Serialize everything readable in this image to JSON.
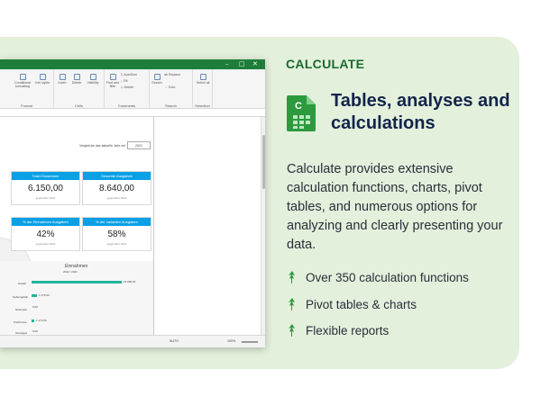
{
  "window": {
    "ribbon_groups": [
      "Format",
      "Cells",
      "Comments",
      "Search",
      "Selection"
    ],
    "ribbon_items": [
      "Conditional formatting",
      "Cell styles",
      "Insert",
      "Delete",
      "Visibility",
      "Find and filter",
      "AutoSum",
      "Fill",
      "Delete",
      "Replace",
      "Search",
      "Goto",
      "Select all"
    ],
    "compare_label": "Vergleiche das aktuelle Jahr mit",
    "compare_year": "2021",
    "kpis": [
      {
        "head": "Total Einnahmen",
        "value": "6.150,00",
        "sub": "gegenüber 2021"
      },
      {
        "head": "Gesamte Ausgaben",
        "value": "8.640,00",
        "sub": "gegenüber 2021"
      },
      {
        "head": "% der Einnahmen Ausgaben",
        "value": "42%",
        "sub": "gegenüber 2021"
      },
      {
        "head": "% der variablen Ausgaben",
        "value": "58%",
        "sub": "gegenüber 2021"
      }
    ],
    "chart_title": "Einnahmen",
    "chart_legend": "2022 / 2021",
    "chart_rows": [
      "Gehalt",
      "Nebengehalt",
      "Nebenjob",
      "Zuschüsse",
      "Sonstiges"
    ],
    "chart_values": [
      "21.000,00",
      "1.176,00",
      "0,00",
      "1.174,00",
      "0,00"
    ],
    "status_zoom": "100%",
    "status_cell": "AUTO"
  },
  "aside": {
    "tag": "CALCULATE",
    "title": "Tables, analyses and calculations",
    "description": "Calculate provides extensive calculation functions, charts, pivot tables, and numerous options for analyzing and clearly presenting your data.",
    "features": [
      "Over 350 calculation functions",
      "Pivot tables & charts",
      "Flexible reports"
    ]
  },
  "colors": {
    "accent": "#1b6a2c",
    "card_bg": "#e3f0dc",
    "title": "#13244a",
    "kpi_header": "#0aa0e6"
  }
}
